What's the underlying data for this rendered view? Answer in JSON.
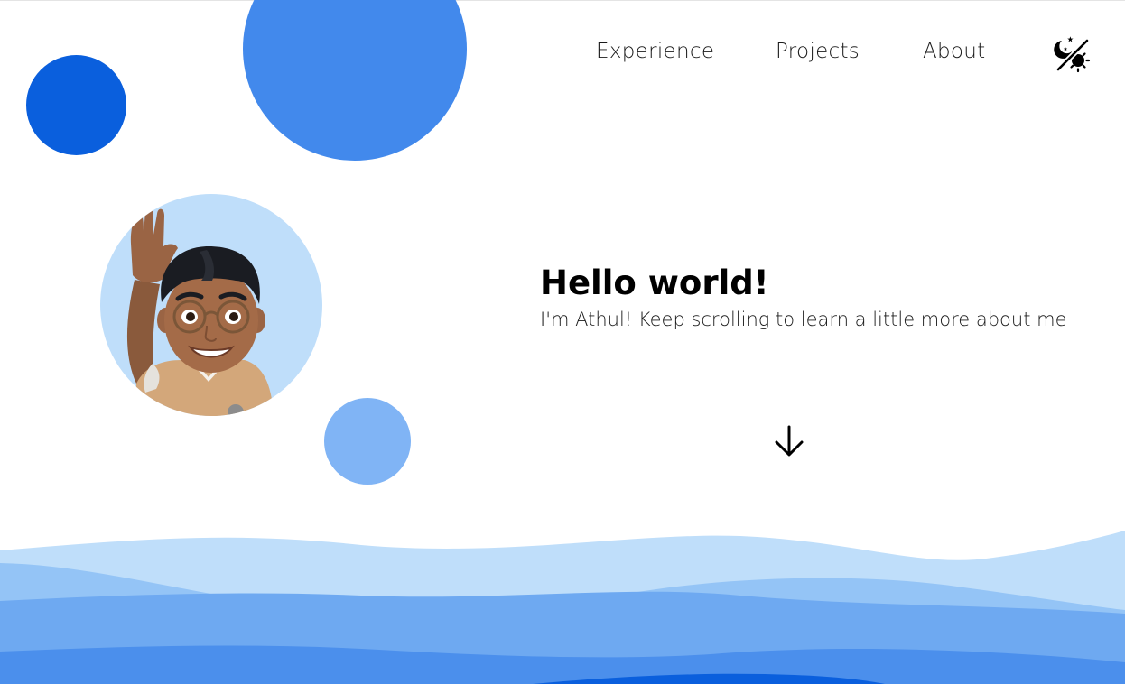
{
  "nav": {
    "items": [
      {
        "label": "Experience"
      },
      {
        "label": "Projects"
      },
      {
        "label": "About"
      }
    ],
    "theme_toggle_icon": "sun-moon-toggle-icon"
  },
  "hero": {
    "title": "Hello world!",
    "subtitle": "I'm Athul! Keep scrolling to learn a little more about me",
    "scroll_icon": "arrow-down-icon"
  },
  "avatar": {
    "icon": "waving-memoji-avatar"
  },
  "colors": {
    "circle_dark": "#0a5fdd",
    "circle_medium": "#4289ec",
    "circle_light": "#80b4f5",
    "avatar_bg": "#bfdefa",
    "wave_1": "#bfdefa",
    "wave_2": "#94c4f6",
    "wave_3": "#6ea9f1",
    "wave_4": "#4b8fec",
    "wave_5": "#0a5fdd"
  }
}
